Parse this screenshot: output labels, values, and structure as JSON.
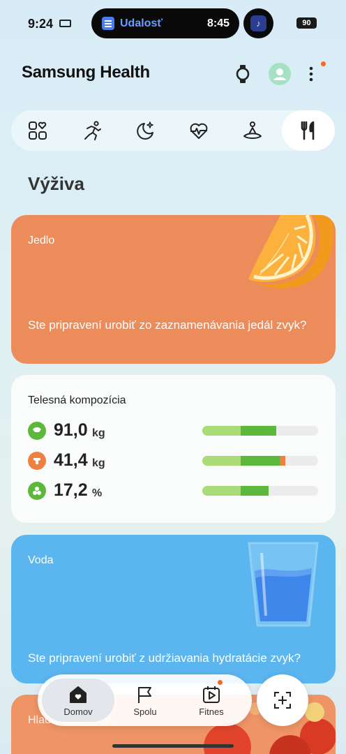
{
  "status_bar": {
    "time": "9:24",
    "event_label": "Udalosť",
    "event_time": "8:45",
    "battery": "90"
  },
  "header": {
    "title": "Samsung Health"
  },
  "category_tabs": [
    {
      "icon": "grid-heart-icon",
      "active": false
    },
    {
      "icon": "running-icon",
      "active": false
    },
    {
      "icon": "moon-sleep-icon",
      "active": false
    },
    {
      "icon": "heart-rate-icon",
      "active": false
    },
    {
      "icon": "meditation-icon",
      "active": false
    },
    {
      "icon": "fork-knife-icon",
      "active": true
    }
  ],
  "section_title": "Výživa",
  "food_card": {
    "title": "Jedlo",
    "text": "Ste pripravení urobiť zo zaznamenávania jedál zvyk?"
  },
  "body_composition": {
    "title": "Telesná kompozícia",
    "metrics": [
      {
        "icon": "body-weight-icon",
        "value": "91,0",
        "unit": "kg",
        "color": "#5cb83a",
        "bar": {
          "light": 0.33,
          "dark": 0.31,
          "accent": 0
        }
      },
      {
        "icon": "muscle-mass-icon",
        "value": "41,4",
        "unit": "kg",
        "color": "#ef8040",
        "bar": {
          "light": 0.33,
          "dark": 0.34,
          "accent": 0.05
        }
      },
      {
        "icon": "body-fat-icon",
        "value": "17,2",
        "unit": "%",
        "color": "#5cb83a",
        "bar": {
          "light": 0.33,
          "dark": 0.24,
          "accent": 0
        }
      }
    ]
  },
  "water_card": {
    "title": "Voda",
    "text": "Ste pripravení urobiť z udržiavania hydratácie zvyk?"
  },
  "fasting_card": {
    "title": "Hladovanie s ktv..."
  },
  "bottom_nav": {
    "items": [
      {
        "label": "Domov",
        "icon": "home-heart-icon",
        "active": true
      },
      {
        "label": "Spolu",
        "icon": "flag-icon",
        "active": false
      },
      {
        "label": "Fitnes",
        "icon": "play-calendar-icon",
        "active": false
      }
    ],
    "fab_icon": "add-scan-icon"
  }
}
